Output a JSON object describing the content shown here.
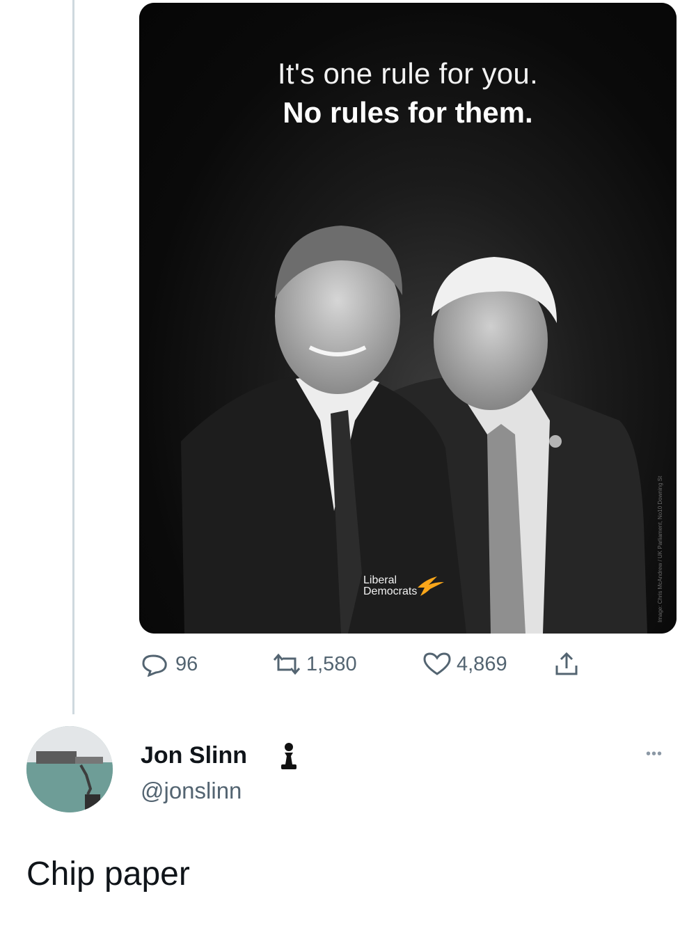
{
  "original_tweet": {
    "image": {
      "headline_line1": "It's one rule for you.",
      "headline_line2": "No rules for them.",
      "logo_line1": "Liberal",
      "logo_line2": "Democrats",
      "logo_color": "#FAA61A",
      "photo_credit": "Image: Chris McAndrew / UK Parliament, No10 Downing St"
    },
    "actions": {
      "replies": "96",
      "retweets": "1,580",
      "likes": "4,869"
    },
    "icons": [
      "reply-icon",
      "retweet-icon",
      "like-icon",
      "share-icon"
    ]
  },
  "reply": {
    "name": "Jon Slinn",
    "handle": "@jonslinn",
    "badge_icon": "chess-pawn-icon",
    "text": "Chip paper",
    "more_label": "•••"
  },
  "colors": {
    "text_primary": "#0f1419",
    "text_secondary": "#536471",
    "thread_line": "#cfd9de"
  }
}
